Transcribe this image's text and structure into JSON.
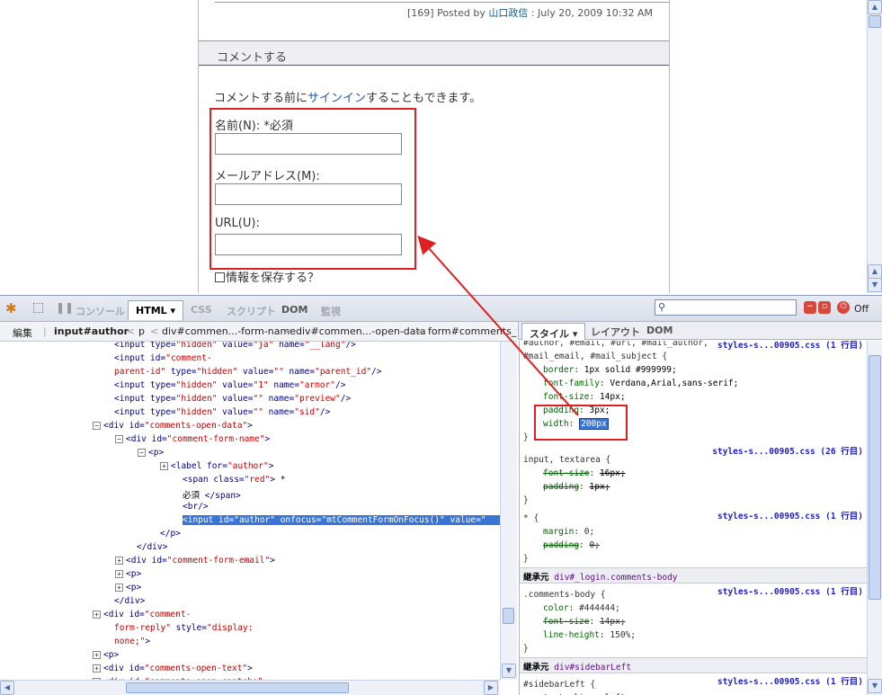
{
  "page": {
    "post_meta_prefix": "[169] Posted by ",
    "post_author": "山口政信",
    "post_meta_suffix": " : July 20, 2009 10:32 AM",
    "comment_heading": "コメントする",
    "signin_before": "コメントする前に",
    "signin_link": "サインイン",
    "signin_after": "することもできます。",
    "name_label": "名前(N): *必須",
    "email_label": "メールアドレス(M):",
    "url_label": "URL(U):",
    "save_label": "情報を保存する？"
  },
  "firebug": {
    "tabs": [
      "コンソール",
      "HTML",
      "CSS",
      "スクリプト",
      "DOM",
      "監視"
    ],
    "active_tab": "HTML",
    "off_label": "Off",
    "breadcrumb": [
      "編集",
      "input#author",
      "p",
      "div#commen...-form-name",
      "div#commen...-open-data",
      "form#comments_f"
    ],
    "right_tabs": [
      "スタイル",
      "レイアウト",
      "DOM"
    ]
  },
  "html_lines": [
    {
      "exp": "",
      "parts": [
        [
          "tg",
          "<input "
        ],
        [
          "an",
          "type="
        ],
        [
          "av",
          "\"hidden\" "
        ],
        [
          "an",
          "value="
        ],
        [
          "av",
          "\"ja\" "
        ],
        [
          "an",
          "name="
        ],
        [
          "av",
          "\"__lang\""
        ],
        [
          "tg",
          "/>"
        ]
      ]
    },
    {
      "exp": "",
      "parts": [
        [
          "tg",
          "<input "
        ],
        [
          "an",
          "id="
        ],
        [
          "av",
          "\"comment-"
        ]
      ]
    },
    {
      "exp": "",
      "parts": [
        [
          "av",
          "parent-id\" "
        ],
        [
          "an",
          "type="
        ],
        [
          "av",
          "\"hidden\" "
        ],
        [
          "an",
          "value="
        ],
        [
          "av",
          "\"\" "
        ],
        [
          "an",
          "name="
        ],
        [
          "av",
          "\"parent_id\""
        ],
        [
          "tg",
          "/>"
        ]
      ]
    },
    {
      "exp": "",
      "parts": [
        [
          "tg",
          "<input "
        ],
        [
          "an",
          "type="
        ],
        [
          "av",
          "\"hidden\" "
        ],
        [
          "an",
          "value="
        ],
        [
          "av",
          "\"1\" "
        ],
        [
          "an",
          "name="
        ],
        [
          "av",
          "\"armor\""
        ],
        [
          "tg",
          "/>"
        ]
      ]
    },
    {
      "exp": "",
      "parts": [
        [
          "tg",
          "<input "
        ],
        [
          "an",
          "type="
        ],
        [
          "av",
          "\"hidden\" "
        ],
        [
          "an",
          "value="
        ],
        [
          "av",
          "\"\" "
        ],
        [
          "an",
          "name="
        ],
        [
          "av",
          "\"preview\""
        ],
        [
          "tg",
          "/>"
        ]
      ]
    },
    {
      "exp": "",
      "parts": [
        [
          "tg",
          "<input "
        ],
        [
          "an",
          "type="
        ],
        [
          "av",
          "\"hidden\" "
        ],
        [
          "an",
          "value="
        ],
        [
          "av",
          "\"\" "
        ],
        [
          "an",
          "name="
        ],
        [
          "av",
          "\"sid\""
        ],
        [
          "tg",
          "/>"
        ]
      ]
    },
    {
      "exp": "−",
      "parts": [
        [
          "tg",
          "<div "
        ],
        [
          "an",
          "id="
        ],
        [
          "av",
          "\"comments-open-data\""
        ],
        [
          "tg",
          ">"
        ]
      ]
    },
    {
      "exp": "−",
      "parts": [
        [
          "tg",
          "<div "
        ],
        [
          "an",
          "id="
        ],
        [
          "av",
          "\"comment-form-name\""
        ],
        [
          "tg",
          ">"
        ]
      ]
    },
    {
      "exp": "−",
      "parts": [
        [
          "tg",
          "<p>"
        ]
      ]
    },
    {
      "exp": "+",
      "parts": [
        [
          "tg",
          "<label "
        ],
        [
          "an",
          "for="
        ],
        [
          "av",
          "\"author\""
        ],
        [
          "tg",
          ">"
        ]
      ]
    },
    {
      "exp": "",
      "parts": [
        [
          "tg",
          "<span "
        ],
        [
          "an",
          "class="
        ],
        [
          "av",
          "\"red\""
        ],
        [
          "tg",
          ">"
        ],
        [
          "tx",
          " *"
        ]
      ]
    },
    {
      "exp": "",
      "parts": [
        [
          "tx",
          "必須 "
        ],
        [
          "tg",
          "</span>"
        ]
      ]
    },
    {
      "exp": "",
      "parts": [
        [
          "tg",
          "<br/>"
        ]
      ]
    },
    {
      "exp": "",
      "parts": [
        [
          "tg",
          "<input "
        ],
        [
          "an",
          "id="
        ],
        [
          "av",
          "\"author\" "
        ],
        [
          "an",
          "onfocus="
        ],
        [
          "av",
          "\"mtCommentFormOnFocus()\" "
        ],
        [
          "an",
          "value="
        ],
        [
          "av",
          "\""
        ]
      ]
    },
    {
      "exp": "",
      "parts": [
        [
          "tg",
          "</p>"
        ]
      ]
    },
    {
      "exp": "",
      "parts": [
        [
          "tg",
          "</div>"
        ]
      ]
    },
    {
      "exp": "+",
      "parts": [
        [
          "tg",
          "<div "
        ],
        [
          "an",
          "id="
        ],
        [
          "av",
          "\"comment-form-email\""
        ],
        [
          "tg",
          ">"
        ]
      ]
    },
    {
      "exp": "+",
      "parts": [
        [
          "tg",
          "<p>"
        ]
      ]
    },
    {
      "exp": "+",
      "parts": [
        [
          "tg",
          "<p>"
        ]
      ]
    },
    {
      "exp": "",
      "parts": [
        [
          "tg",
          "</div>"
        ]
      ]
    },
    {
      "exp": "+",
      "parts": [
        [
          "tg",
          "<div "
        ],
        [
          "an",
          "id="
        ],
        [
          "av",
          "\"comment-"
        ]
      ]
    },
    {
      "exp": "",
      "parts": [
        [
          "av",
          "form-reply\" "
        ],
        [
          "an",
          "style="
        ],
        [
          "av",
          "\"display:"
        ]
      ]
    },
    {
      "exp": "",
      "parts": [
        [
          "av",
          "none;\""
        ],
        [
          "tg",
          ">"
        ]
      ]
    },
    {
      "exp": "+",
      "parts": [
        [
          "tg",
          "<p>"
        ]
      ]
    },
    {
      "exp": "+",
      "parts": [
        [
          "tg",
          "<div "
        ],
        [
          "an",
          "id="
        ],
        [
          "av",
          "\"comments-open-text\""
        ],
        [
          "tg",
          ">"
        ]
      ]
    },
    {
      "exp": "+",
      "parts": [
        [
          "tg",
          "<div "
        ],
        [
          "an",
          "id="
        ],
        [
          "av",
          "\"comments-open-captcha\""
        ]
      ]
    }
  ],
  "css_rules": {
    "rule1_selector_a": "#author, #email, #url, #mail_author,",
    "rule1_selector_b": "#mail_email, #mail_subject {",
    "rule1_src": "styles-s...00905.css (1 行目)",
    "rule1_props": [
      [
        "border",
        "1px solid #999999;"
      ],
      [
        "font-family",
        "Verdana,Arial,sans-serif;"
      ],
      [
        "font-size",
        "14px;"
      ],
      [
        "padding",
        "3px;"
      ]
    ],
    "width_name": "width",
    "width_value": "200px",
    "rule2_selector": "input, textarea {",
    "rule2_src": "styles-s...00905.css (26 行目)",
    "rule2_props": [
      [
        "font-size",
        "16px;"
      ],
      [
        "padding",
        "1px;"
      ]
    ],
    "rule3_selector": "* {",
    "rule3_src": "styles-s...00905.css (1 行目)",
    "rule3_props": [
      [
        "margin",
        "0;"
      ],
      [
        "padding",
        "0;"
      ]
    ],
    "inherit1_label": "継承元",
    "inherit1_link": "div#_login.comments-body",
    "rule4_selector": ".comments-body {",
    "rule4_src": "styles-s...00905.css (1 行目)",
    "rule4_props": [
      [
        "color",
        "#444444;"
      ],
      [
        "font-size",
        "14px;"
      ],
      [
        "line-height",
        "150%;"
      ]
    ],
    "inherit2_label": "継承元",
    "inherit2_link": "div#sidebarLeft",
    "rule5_selector": "#sidebarLeft {",
    "rule5_src": "styles-s...00905.css (1 行目)",
    "rule5_props": [
      [
        "text-align",
        "left;"
      ]
    ],
    "close": "}"
  },
  "colors": {
    "highlight": "#e02020",
    "selection": "#3875d7"
  }
}
